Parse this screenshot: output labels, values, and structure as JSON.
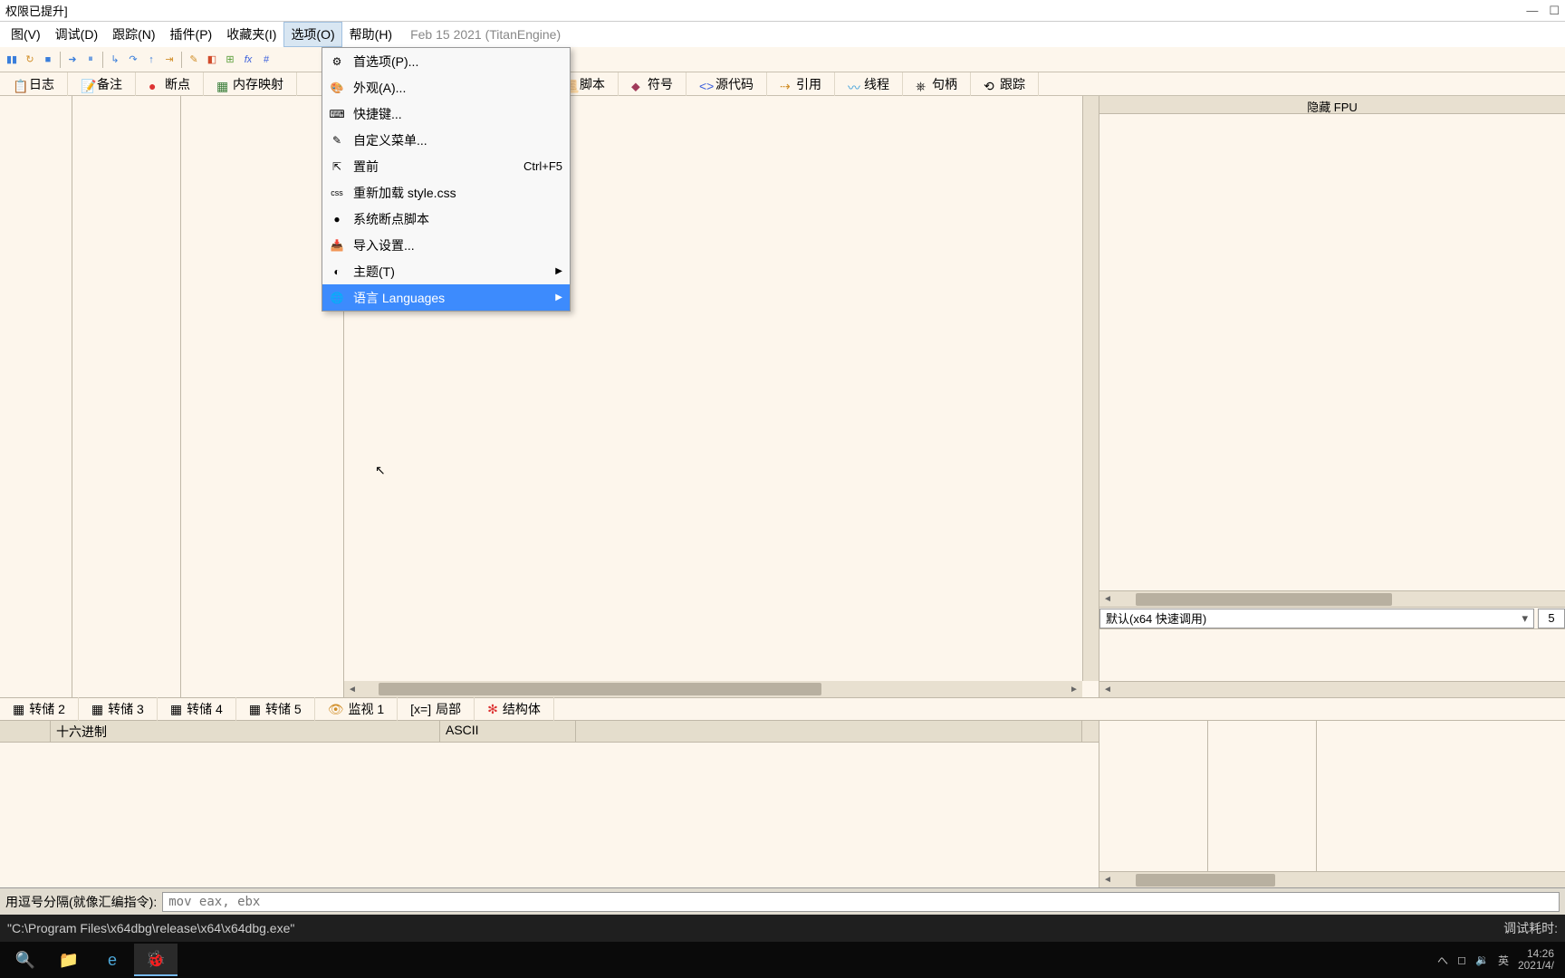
{
  "title_suffix": "权限已提升]",
  "window_buttons": {
    "min": "—",
    "max": "☐"
  },
  "menu": {
    "items": [
      "图(V)",
      "调试(D)",
      "跟踪(N)",
      "插件(P)",
      "收藏夹(I)",
      "选项(O)",
      "帮助(H)"
    ],
    "open_index": 5,
    "date": "Feb 15 2021 (TitanEngine)"
  },
  "dropdown": {
    "items": [
      {
        "icon": "⚙",
        "label": "首选项(P)...",
        "shortcut": "",
        "submenu": false
      },
      {
        "icon": "🎨",
        "label": "外观(A)...",
        "shortcut": "",
        "submenu": false
      },
      {
        "icon": "⌨",
        "label": "快捷键...",
        "shortcut": "",
        "submenu": false
      },
      {
        "icon": "✎",
        "label": "自定义菜单...",
        "shortcut": "",
        "submenu": false
      },
      {
        "icon": "⇱",
        "label": "置前",
        "shortcut": "Ctrl+F5",
        "submenu": false
      },
      {
        "icon": "css",
        "label": "重新加载 style.css",
        "shortcut": "",
        "submenu": false
      },
      {
        "icon": "●",
        "label": "系统断点脚本",
        "shortcut": "",
        "submenu": false
      },
      {
        "icon": "📥",
        "label": "导入设置...",
        "shortcut": "",
        "submenu": false
      },
      {
        "icon": "◐",
        "label": "主题(T)",
        "shortcut": "",
        "submenu": true
      },
      {
        "icon": "🌐",
        "label": "语言 Languages",
        "shortcut": "",
        "submenu": true,
        "highlight": true
      }
    ]
  },
  "tabs": [
    "日志",
    "备注",
    "断点",
    "内存映射",
    "脚本",
    "符号",
    "源代码",
    "引用",
    "线程",
    "句柄",
    "跟踪"
  ],
  "tab_icons": [
    "📋",
    "📝",
    "●",
    "▦",
    "📜",
    "⬥",
    "<>",
    "⇢",
    "〰",
    "⎈",
    "⟲"
  ],
  "fpu_header": "隐藏 FPU",
  "calling_conv": "默认(x64 快速调用)",
  "spin_value": "5",
  "bottom_tabs": [
    "转储 2",
    "转储 3",
    "转储 4",
    "转储 5",
    "监视 1",
    "局部",
    "结构体"
  ],
  "bottom_tab_icons": [
    "▦",
    "▦",
    "▦",
    "▦",
    "👁",
    "[x=]",
    "✻"
  ],
  "dump_headers": {
    "hex": "十六进制",
    "ascii": "ASCII"
  },
  "cmd_label": "用逗号分隔(就像汇编指令):",
  "cmd_value": "mov eax, ebx",
  "status_path": "\"C:\\Program Files\\x64dbg\\release\\x64\\x64dbg.exe\"",
  "status_right": "调试耗时:",
  "tray": {
    "net": "へ",
    "wifi": "◻",
    "sound": "🔉",
    "ime": "英",
    "time": "14:26",
    "date": "2021/4/"
  }
}
